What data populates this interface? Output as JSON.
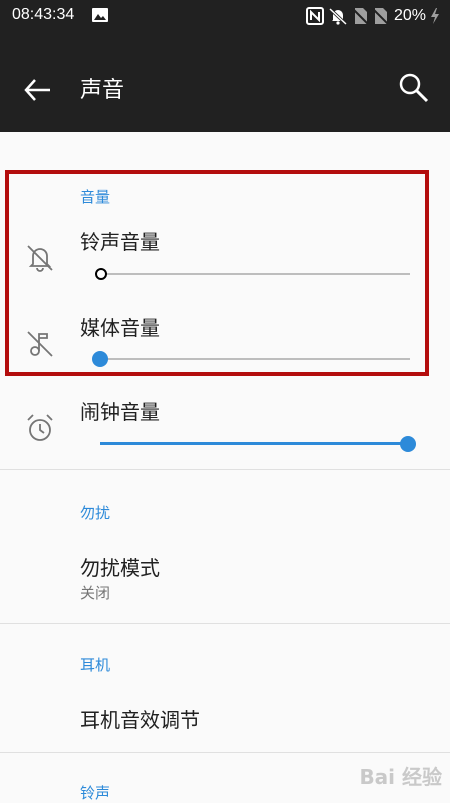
{
  "status_bar": {
    "time": "08:43:34",
    "battery": "20%",
    "icons": [
      "image-icon",
      "nfc-icon",
      "bell-off-icon",
      "no-sim-icon",
      "no-sim-icon",
      "battery-charging-icon"
    ]
  },
  "app_bar": {
    "title": "声音",
    "back_icon": "arrow-left-icon",
    "search_icon": "search-icon"
  },
  "sections": {
    "volume": {
      "header": "音量",
      "ringtone": {
        "label": "铃声音量",
        "level": 0
      },
      "media": {
        "label": "媒体音量",
        "level": 0
      },
      "alarm": {
        "label": "闹钟音量",
        "level": 1.0
      }
    },
    "dnd": {
      "header": "勿扰",
      "mode": {
        "label": "勿扰模式",
        "value": "关闭"
      }
    },
    "earphone": {
      "header": "耳机",
      "effect": {
        "label": "耳机音效调节"
      }
    },
    "ringtone": {
      "header": "铃声"
    }
  },
  "colors": {
    "accent": "#2d8ad9",
    "highlight": "#b30d0d",
    "app_bar": "#212121"
  },
  "watermark": "Bai 经验"
}
